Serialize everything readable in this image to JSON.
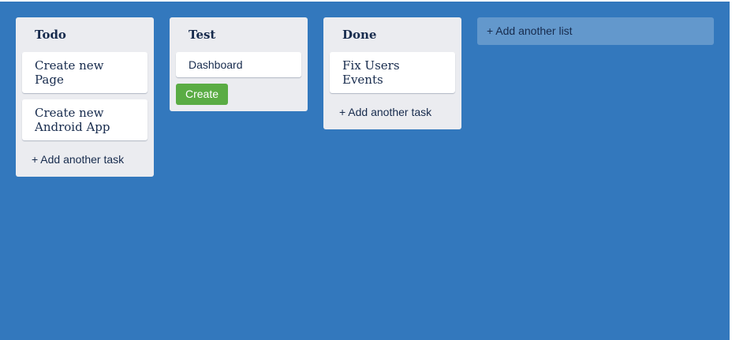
{
  "board": {
    "background": "#3378bd",
    "lists": [
      {
        "title": "Todo",
        "cards": [
          "Create new Page",
          "Create new Android App"
        ],
        "add_task_label": "+ Add another task"
      },
      {
        "title": "Test",
        "cards": [
          "Dashboard"
        ],
        "create_label": "Create"
      },
      {
        "title": "Done",
        "cards": [
          "Fix Users Events"
        ],
        "add_task_label": "+ Add another task"
      }
    ],
    "add_list_label": "+ Add another list"
  },
  "colors": {
    "board_background": "#3378bd",
    "list_background": "#ebecf0",
    "create_button": "#5aac44"
  }
}
